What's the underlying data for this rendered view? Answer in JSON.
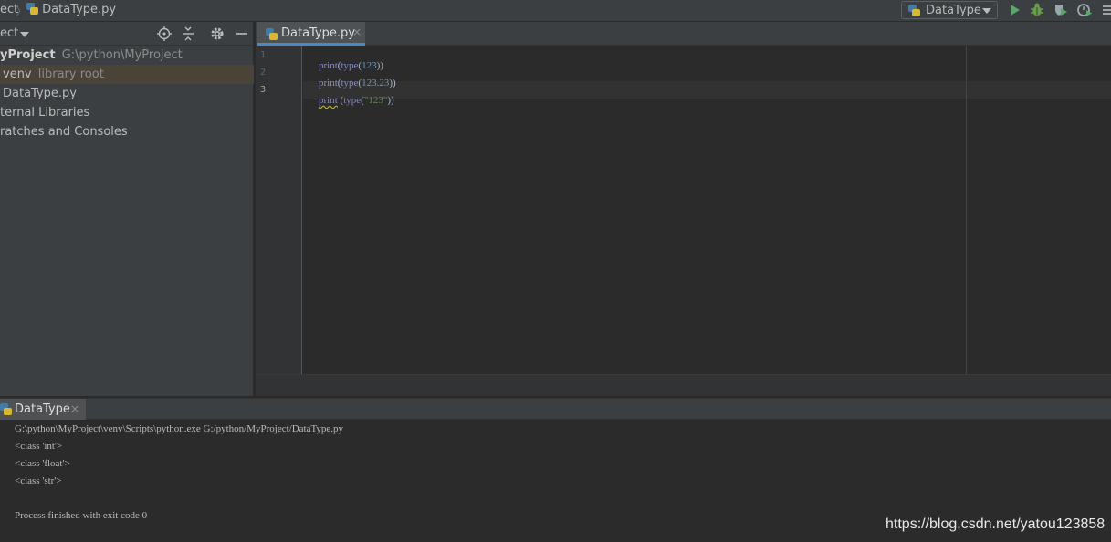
{
  "navbar": {
    "crumb_project": "ect",
    "crumb_separator": "〉",
    "crumb_file": "DataType.py"
  },
  "toolbar": {
    "run_config_label": "DataType",
    "icons": [
      "run-icon",
      "debug-icon",
      "coverage-icon",
      "profile-icon",
      "more-icon"
    ]
  },
  "project": {
    "title": "ect",
    "header_icons": [
      "locate-icon",
      "collapse-icon",
      "settings-icon",
      "hide-icon"
    ],
    "tree": [
      {
        "label": "yProject",
        "suffix": "G:\\python\\MyProject"
      },
      {
        "label": "venv",
        "suffix": "library root"
      },
      {
        "label": "DataType.py"
      },
      {
        "label": "ternal Libraries"
      },
      {
        "label": "ratches and Consoles"
      }
    ]
  },
  "editor": {
    "tab_label": "DataType.py",
    "tab_close": "×",
    "line_numbers": [
      "1",
      "2",
      "3"
    ],
    "code": [
      {
        "fn": "print",
        "open": "(",
        "inner_fn": "type",
        "open2": "(",
        "arg": "123",
        "close": "))"
      },
      {
        "fn": "print",
        "open": "(",
        "inner_fn": "type",
        "open2": "(",
        "arg": "123.23",
        "close": "))"
      },
      {
        "fn": "print",
        "open": " (",
        "inner_fn": "type",
        "open2": "(",
        "arg": "\"123\"",
        "close": "))"
      }
    ]
  },
  "run": {
    "tab_label": "DataType",
    "tab_close": "×",
    "console": [
      "G:\\python\\MyProject\\venv\\Scripts\\python.exe G:/python/MyProject/DataType.py",
      "<class 'int'>",
      "<class 'float'>",
      "<class 'str'>",
      "",
      "Process finished with exit code 0"
    ]
  },
  "watermark": "https://blog.csdn.net/yatou123858",
  "colors": {
    "accent": "#4a88c7",
    "keyword": "#8888c6",
    "number": "#6897bb",
    "string": "#6a8759",
    "run_green": "#59a869",
    "debug_green": "#68a04b"
  }
}
